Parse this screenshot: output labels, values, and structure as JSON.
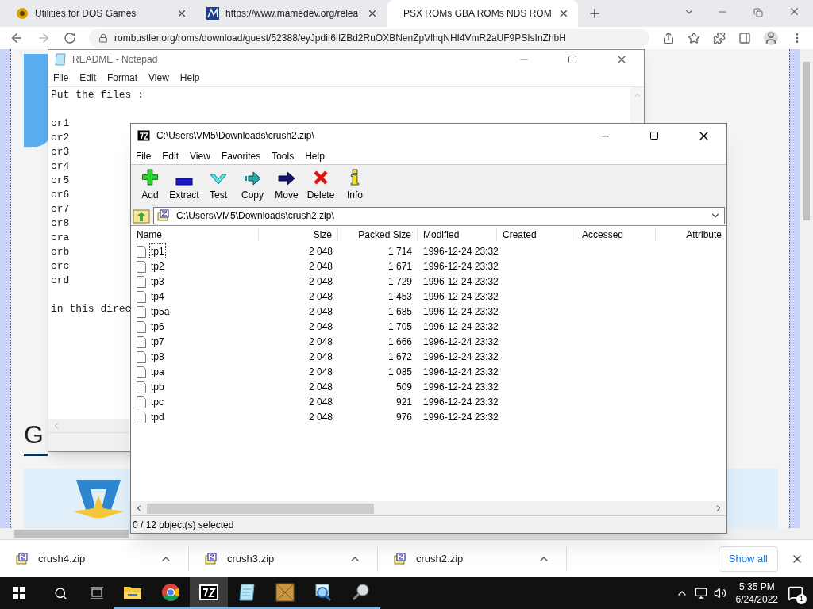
{
  "browser": {
    "tabs": [
      {
        "title": "Utilities for DOS Games",
        "kind": "dos",
        "selected": false
      },
      {
        "title": "https://www.mamedev.org/relea",
        "kind": "mame",
        "selected": false
      },
      {
        "title": "PSX ROMs GBA ROMs NDS ROM",
        "kind": "rom",
        "selected": true
      }
    ],
    "url": "rombustler.org/roms/download/guest/52388/eyJpdiI6IlZBd2RuOXBNenZpVlhqNHI4VmR2aUF9PSIsInZhbH",
    "page": {
      "heading": "G"
    },
    "downloads": [
      {
        "name": "crush4.zip"
      },
      {
        "name": "crush3.zip"
      },
      {
        "name": "crush2.zip"
      }
    ],
    "show_all": "Show all"
  },
  "notepad": {
    "title": "README - Notepad",
    "menu": [
      "File",
      "Edit",
      "Format",
      "View",
      "Help"
    ],
    "paragraphs": [
      {
        "lines": [
          "Put the files :"
        ]
      },
      {
        "lines": [
          "cr1",
          "cr2",
          "cr3",
          "cr4",
          "cr5",
          "cr6",
          "cr7",
          "cr8",
          "cra",
          "crb",
          "crc",
          "crd"
        ]
      },
      {
        "lines": [
          "in this direc"
        ]
      }
    ]
  },
  "sevenzip": {
    "title": "C:\\Users\\VM5\\Downloads\\crush2.zip\\",
    "menu": [
      "File",
      "Edit",
      "View",
      "Favorites",
      "Tools",
      "Help"
    ],
    "toolbar": [
      {
        "label": "Add",
        "kind": "add"
      },
      {
        "label": "Extract",
        "kind": "extract"
      },
      {
        "label": "Test",
        "kind": "test"
      },
      {
        "label": "Copy",
        "kind": "copy"
      },
      {
        "label": "Move",
        "kind": "move"
      },
      {
        "label": "Delete",
        "kind": "delete"
      },
      {
        "label": "Info",
        "kind": "info"
      }
    ],
    "path": "C:\\Users\\VM5\\Downloads\\crush2.zip\\",
    "columns": [
      "Name",
      "Size",
      "Packed Size",
      "Modified",
      "Created",
      "Accessed",
      "Attribute"
    ],
    "rows": [
      {
        "name": "tp1",
        "size": "2 048",
        "packed": "1 714",
        "modified": "1996-12-24 23:32",
        "focused": true
      },
      {
        "name": "tp2",
        "size": "2 048",
        "packed": "1 671",
        "modified": "1996-12-24 23:32",
        "focused": false
      },
      {
        "name": "tp3",
        "size": "2 048",
        "packed": "1 729",
        "modified": "1996-12-24 23:32",
        "focused": false
      },
      {
        "name": "tp4",
        "size": "2 048",
        "packed": "1 453",
        "modified": "1996-12-24 23:32",
        "focused": false
      },
      {
        "name": "tp5a",
        "size": "2 048",
        "packed": "1 685",
        "modified": "1996-12-24 23:32",
        "focused": false
      },
      {
        "name": "tp6",
        "size": "2 048",
        "packed": "1 705",
        "modified": "1996-12-24 23:32",
        "focused": false
      },
      {
        "name": "tp7",
        "size": "2 048",
        "packed": "1 666",
        "modified": "1996-12-24 23:32",
        "focused": false
      },
      {
        "name": "tp8",
        "size": "2 048",
        "packed": "1 672",
        "modified": "1996-12-24 23:32",
        "focused": false
      },
      {
        "name": "tpa",
        "size": "2 048",
        "packed": "1 085",
        "modified": "1996-12-24 23:32",
        "focused": false
      },
      {
        "name": "tpb",
        "size": "2 048",
        "packed": "509",
        "modified": "1996-12-24 23:32",
        "focused": false
      },
      {
        "name": "tpc",
        "size": "2 048",
        "packed": "921",
        "modified": "1996-12-24 23:32",
        "focused": false
      },
      {
        "name": "tpd",
        "size": "2 048",
        "packed": "976",
        "modified": "1996-12-24 23:32",
        "focused": false
      }
    ],
    "status": "0 / 12 object(s) selected"
  },
  "taskbar": {
    "apps": [
      {
        "kind": "explorer",
        "selected": false
      },
      {
        "kind": "chrome",
        "selected": false
      },
      {
        "kind": "sevenzip",
        "selected": true
      },
      {
        "kind": "notepad",
        "selected": false
      },
      {
        "kind": "dosbox",
        "selected": false
      },
      {
        "kind": "magnifier",
        "selected": false
      },
      {
        "kind": "tool",
        "selected": false
      }
    ],
    "time": "5:35 PM",
    "date": "6/24/2022",
    "notifications": "1"
  }
}
